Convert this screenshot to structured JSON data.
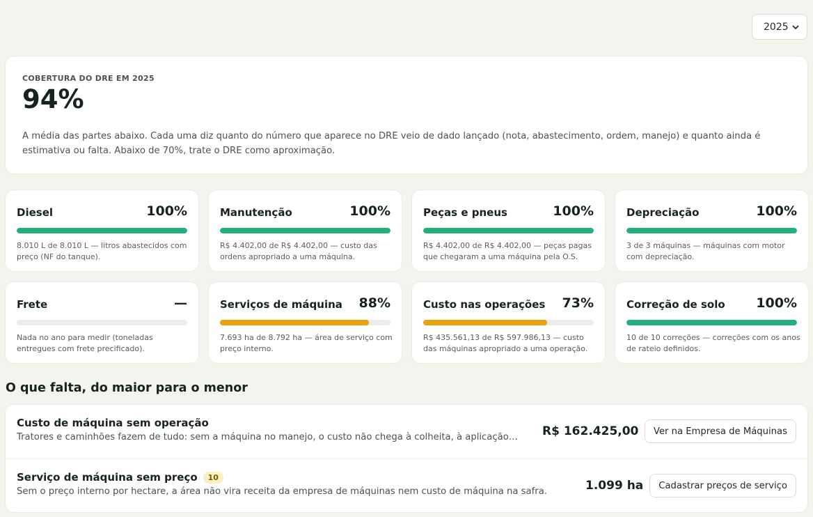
{
  "year_select": {
    "value": "2025"
  },
  "hero": {
    "kicker": "COBERTURA DO DRE EM 2025",
    "value": "94%",
    "description": "A média das partes abaixo. Cada uma diz quanto do número que aparece no DRE veio de dado lançado (nota, abastecimento, ordem, manejo) e quanto ainda é estimativa ou falta. Abaixo de 70%, trate o DRE como aproximação."
  },
  "cards": [
    {
      "name": "Diesel",
      "pct": "100%",
      "fill": 1.0,
      "color": "#21b07a",
      "note": "8.010 L de 8.010 L — litros abastecidos com preço (NF do tanque)."
    },
    {
      "name": "Manutenção",
      "pct": "100%",
      "fill": 1.0,
      "color": "#21b07a",
      "note": "R$ 4.402,00 de R$ 4.402,00 — custo das ordens apropriado a uma máquina."
    },
    {
      "name": "Peças e pneus",
      "pct": "100%",
      "fill": 1.0,
      "color": "#21b07a",
      "note": "R$ 4.402,00 de R$ 4.402,00 — peças pagas que chegaram a uma máquina pela O.S."
    },
    {
      "name": "Depreciação",
      "pct": "100%",
      "fill": 1.0,
      "color": "#21b07a",
      "note": "3 de 3 máquinas — máquinas com motor com depreciação."
    },
    {
      "name": "Frete",
      "pct": "—",
      "fill": 0,
      "color": "#21b07a",
      "note": "Nada no ano para medir (toneladas entregues com frete precificado)."
    },
    {
      "name": "Serviços de máquina",
      "pct": "88%",
      "fill": 0.875,
      "color": "#e8a20d",
      "note": "7.693 ha de 8.792 ha — área de serviço com preço interno."
    },
    {
      "name": "Custo nas operações",
      "pct": "73%",
      "fill": 0.728,
      "color": "#e8a20d",
      "note": "R$ 435.561,13 de R$ 597.986,13 — custo das máquinas apropriado a uma operação."
    },
    {
      "name": "Correção de solo",
      "pct": "100%",
      "fill": 1.0,
      "color": "#21b07a",
      "note": "10 de 10 correções — correções com os anos de rateio definidos."
    }
  ],
  "missing": {
    "title": "O que falta, do maior para o menor",
    "items": [
      {
        "title": "Custo de máquina sem operação",
        "badge": "",
        "subtitle": "Tratores e caminhões fazem de tudo: sem a máquina no manejo, o custo não chega à colheita, à aplicação…",
        "amount": "R$ 162.425,00",
        "button": "Ver na Empresa de Máquinas"
      },
      {
        "title": "Serviço de máquina sem preço",
        "badge": "10",
        "subtitle": "Sem o preço interno por hectare, a área não vira receita da empresa de máquinas nem custo de máquina na safra.",
        "amount": "1.099 ha",
        "button": "Cadastrar preços de serviço"
      }
    ]
  }
}
